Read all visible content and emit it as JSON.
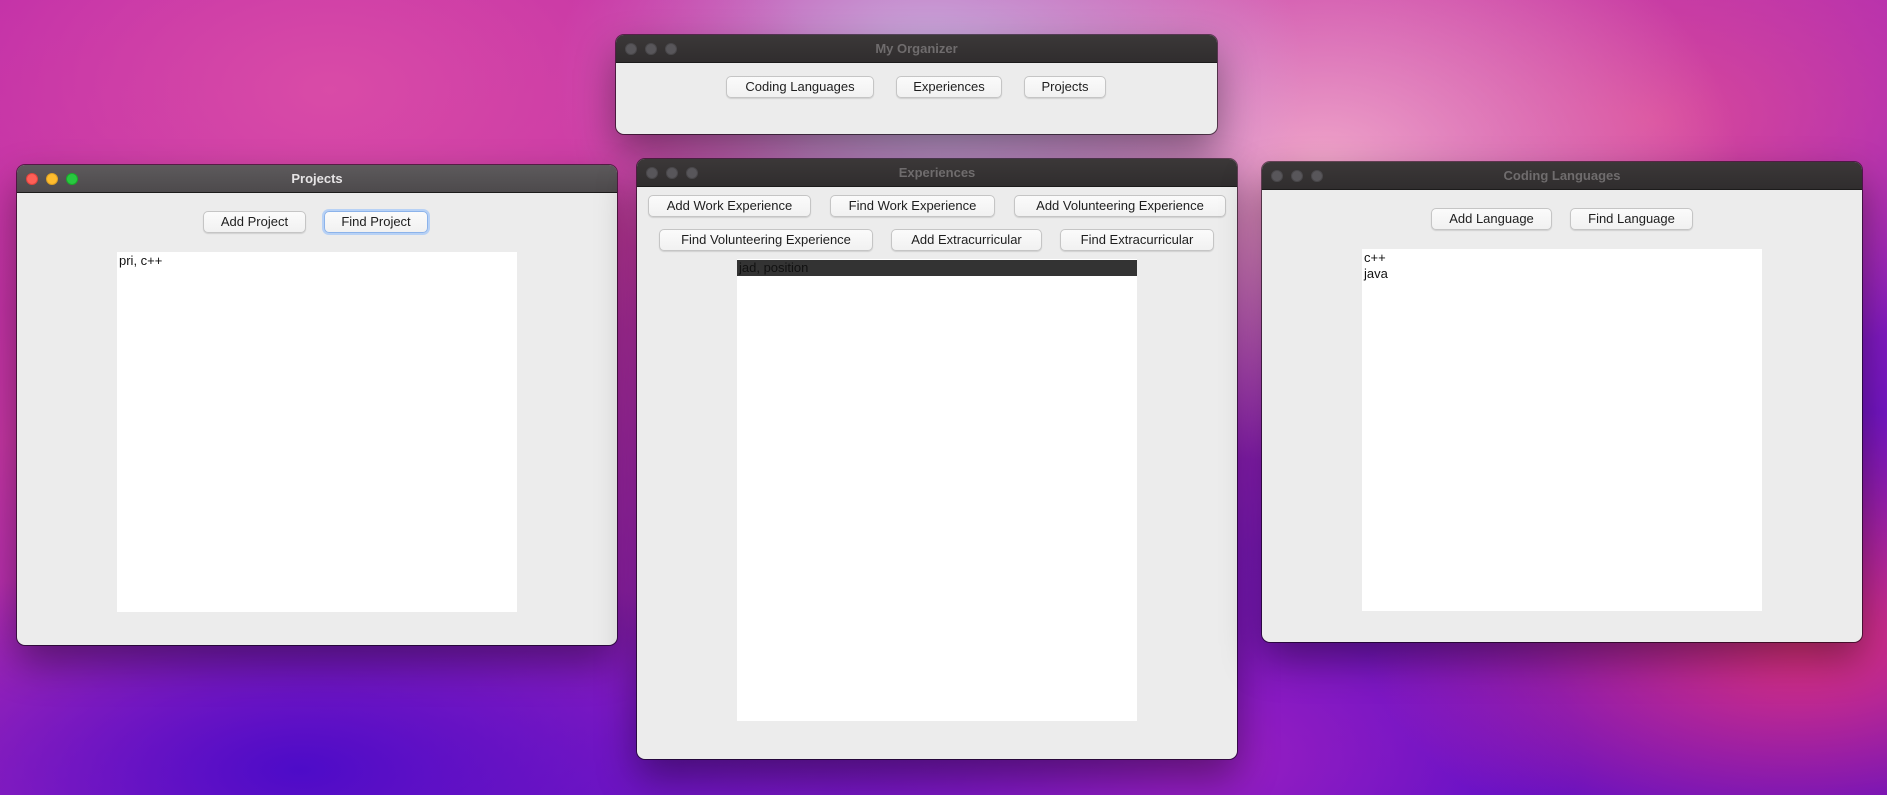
{
  "organizer": {
    "title": "My Organizer",
    "buttons": [
      "Coding Languages",
      "Experiences",
      "Projects"
    ]
  },
  "projects": {
    "title": "Projects",
    "add_label": "Add Project",
    "find_label": "Find Project",
    "items": [
      "pri, c++"
    ]
  },
  "experiences": {
    "title": "Experiences",
    "add_work_label": "Add Work Experience",
    "find_work_label": "Find Work Experience",
    "add_volunteering_label": "Add Volunteering Experience",
    "find_volunteering_label": "Find Volunteering Experience",
    "add_extracurricular_label": "Add Extracurricular",
    "find_extracurricular_label": "Find Extracurricular",
    "items": [
      "jad, position"
    ]
  },
  "languages": {
    "title": "Coding Languages",
    "add_label": "Add Language",
    "find_label": "Find Language",
    "items": [
      "c++",
      "java"
    ]
  }
}
